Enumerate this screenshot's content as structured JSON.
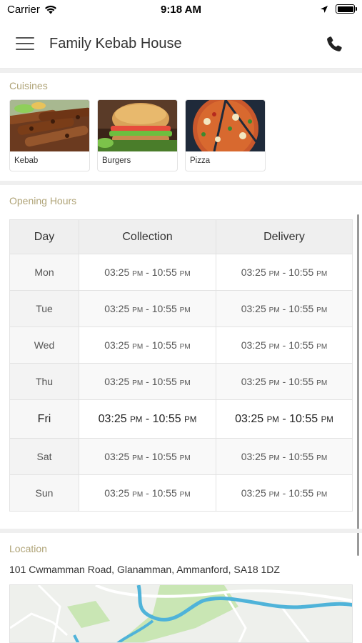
{
  "status_bar": {
    "carrier": "Carrier",
    "time": "9:18 AM"
  },
  "header": {
    "title": "Family Kebab House",
    "menu_icon": "hamburger-menu-icon",
    "phone_icon": "phone-icon"
  },
  "cuisines": {
    "label": "Cuisines",
    "items": [
      {
        "label": "Kebab"
      },
      {
        "label": "Burgers"
      },
      {
        "label": "Pizza"
      }
    ]
  },
  "opening_hours": {
    "label": "Opening Hours",
    "columns": [
      "Day",
      "Collection",
      "Delivery"
    ],
    "rows": [
      {
        "day": "Mon",
        "collection": {
          "start": "03:25",
          "start_suffix": "PM",
          "end": "10:55",
          "end_suffix": "PM"
        },
        "delivery": {
          "start": "03:25",
          "start_suffix": "PM",
          "end": "10:55",
          "end_suffix": "PM"
        }
      },
      {
        "day": "Tue",
        "collection": {
          "start": "03:25",
          "start_suffix": "PM",
          "end": "10:55",
          "end_suffix": "PM"
        },
        "delivery": {
          "start": "03:25",
          "start_suffix": "PM",
          "end": "10:55",
          "end_suffix": "PM"
        }
      },
      {
        "day": "Wed",
        "collection": {
          "start": "03:25",
          "start_suffix": "PM",
          "end": "10:55",
          "end_suffix": "PM"
        },
        "delivery": {
          "start": "03:25",
          "start_suffix": "PM",
          "end": "10:55",
          "end_suffix": "PM"
        }
      },
      {
        "day": "Thu",
        "collection": {
          "start": "03:25",
          "start_suffix": "PM",
          "end": "10:55",
          "end_suffix": "PM"
        },
        "delivery": {
          "start": "03:25",
          "start_suffix": "PM",
          "end": "10:55",
          "end_suffix": "PM"
        }
      },
      {
        "day": "Fri",
        "collection": {
          "start": "03:25",
          "start_suffix": "PM",
          "end": "10:55",
          "end_suffix": "PM"
        },
        "delivery": {
          "start": "03:25",
          "start_suffix": "PM",
          "end": "10:55",
          "end_suffix": "PM"
        }
      },
      {
        "day": "Sat",
        "collection": {
          "start": "03:25",
          "start_suffix": "PM",
          "end": "10:55",
          "end_suffix": "PM"
        },
        "delivery": {
          "start": "03:25",
          "start_suffix": "PM",
          "end": "10:55",
          "end_suffix": "PM"
        }
      },
      {
        "day": "Sun",
        "collection": {
          "start": "03:25",
          "start_suffix": "PM",
          "end": "10:55",
          "end_suffix": "PM"
        },
        "delivery": {
          "start": "03:25",
          "start_suffix": "PM",
          "end": "10:55",
          "end_suffix": "PM"
        }
      }
    ]
  },
  "location": {
    "label": "Location",
    "address": "101  Cwmamman Road, Glanamman, Ammanford, SA18 1DZ"
  },
  "colors": {
    "section_label": "#b0a478",
    "header_bg": "#efefef",
    "river": "#4fb3d9",
    "park": "#c9e6b4"
  }
}
